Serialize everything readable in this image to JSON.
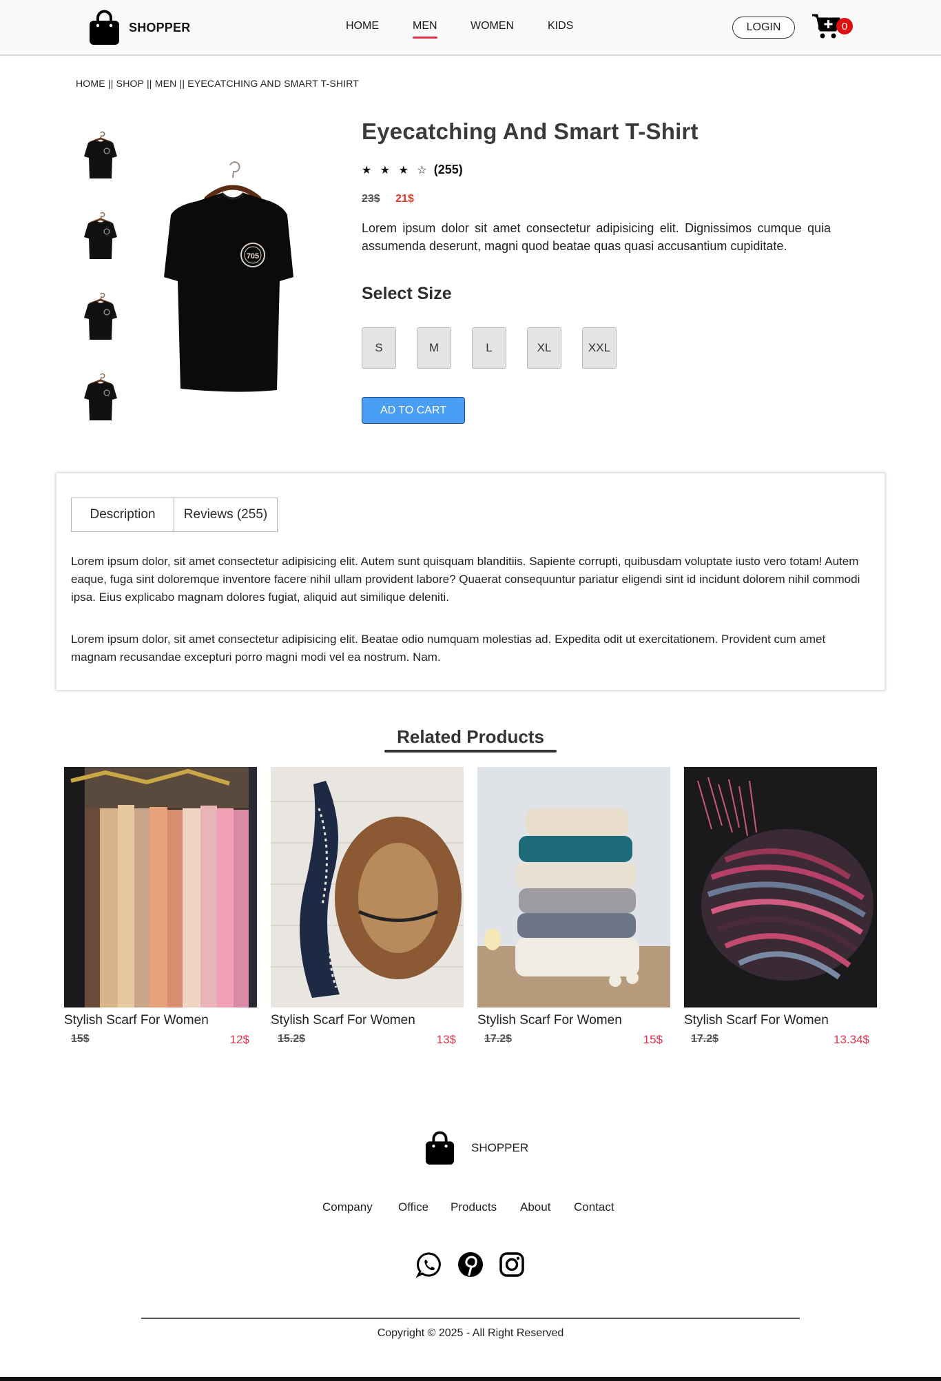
{
  "brand": {
    "name": "SHOPPER"
  },
  "nav": {
    "items": [
      {
        "label": "HOME",
        "active": false
      },
      {
        "label": "MEN",
        "active": true
      },
      {
        "label": "WOMEN",
        "active": false
      },
      {
        "label": "KIDS",
        "active": false
      }
    ],
    "login_label": "LOGIN",
    "cart_count": "0",
    "accent_color": "#e0334a"
  },
  "breadcrumb": "HOME || SHOP || MEN || EYECATCHING AND SMART T-SHIRT",
  "product": {
    "title": "Eyecatching And Smart T-Shirt",
    "stars": "★ ★ ★ ☆",
    "review_count": "(255)",
    "old_price": "23$",
    "new_price": "21$",
    "description": "Lorem ipsum dolor sit amet consectetur adipisicing elit. Dignissimos cumque quia assumenda deserunt, magni quod beatae quas quasi accusantium cupiditate.",
    "select_size_label": "Select Size",
    "sizes": [
      "S",
      "M",
      "L",
      "XL",
      "XXL"
    ],
    "add_to_cart_label": "AD TO CART",
    "shirt_badge_text": "705"
  },
  "description_box": {
    "tabs": [
      "Description",
      "Reviews (255)"
    ],
    "paragraphs": [
      "Lorem ipsum dolor, sit amet consectetur adipisicing elit. Autem sunt quisquam blanditiis. Sapiente corrupti, quibusdam voluptate iusto vero totam! Autem eaque, fuga sint doloremque inventore facere nihil ullam provident labore? Quaerat consequuntur pariatur eligendi sint id incidunt dolorem nihil commodi ipsa. Eius explicabo magnam dolores fugiat, aliquid aut similique deleniti.",
      "Lorem ipsum dolor, sit amet consectetur adipisicing elit. Beatae odio numquam molestias ad. Expedita odit ut exercitationem. Provident cum amet magnam recusandae excepturi porro magni modi vel ea nostrum. Nam."
    ]
  },
  "related": {
    "title": "Related Products",
    "products": [
      {
        "name": "Stylish Scarf For Women",
        "old_price": "15$",
        "new_price": "12$"
      },
      {
        "name": "Stylish Scarf For Women",
        "old_price": "15.2$",
        "new_price": "13$"
      },
      {
        "name": "Stylish Scarf For Women",
        "old_price": "17.2$",
        "new_price": "15$"
      },
      {
        "name": "Stylish Scarf For Women",
        "old_price": "17.2$",
        "new_price": "13.34$"
      }
    ]
  },
  "footer": {
    "brand": "SHOPPER",
    "links": [
      "Company",
      "Office",
      "Products",
      "About",
      "Contact"
    ],
    "socials": [
      "whatsapp-icon",
      "pinterest-icon",
      "instagram-icon"
    ],
    "copyright": "Copyright © 2025 - All Right Reserved"
  }
}
